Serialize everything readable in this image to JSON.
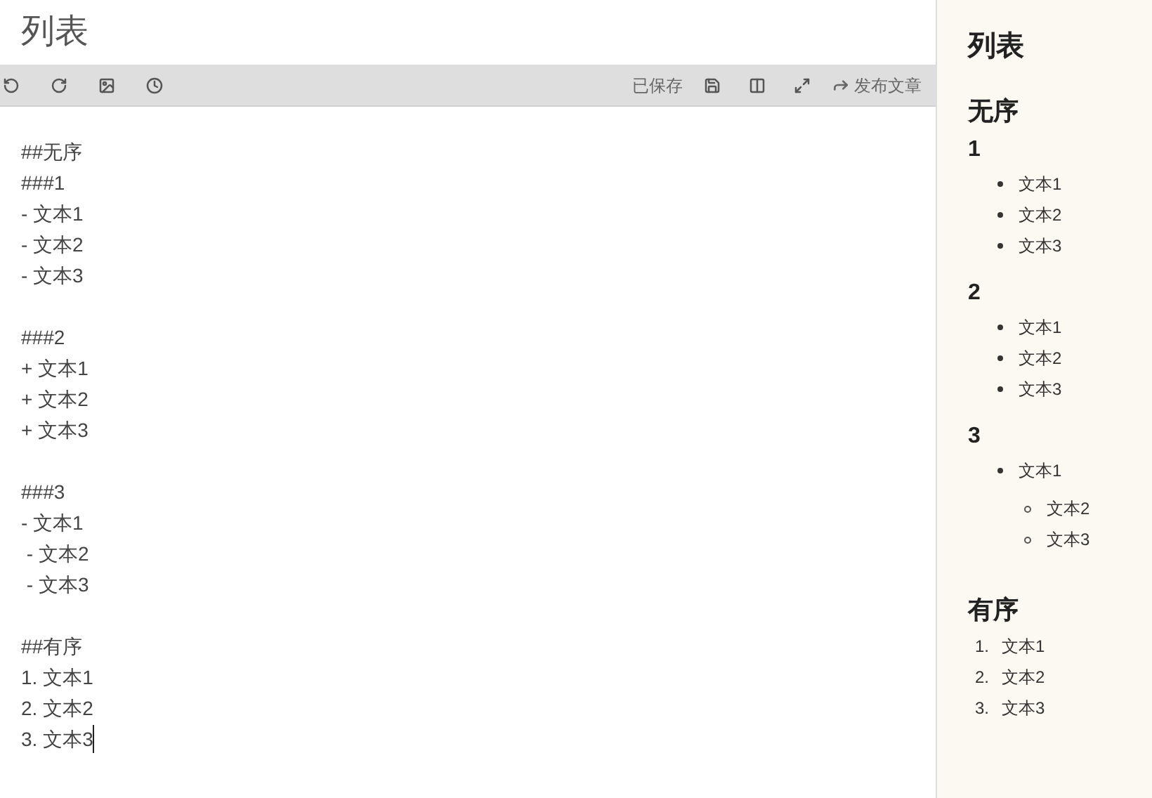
{
  "editor": {
    "title": "列表",
    "toolbar": {
      "status": "已保存",
      "publish_label": "发布文章"
    },
    "blocks": [
      [
        "##无序",
        "###1",
        "- 文本1",
        "- 文本2",
        "- 文本3"
      ],
      [
        "###2",
        "+ 文本1",
        "+ 文本2",
        "+ 文本3"
      ],
      [
        "###3",
        "- 文本1",
        " - 文本2",
        " - 文本3"
      ],
      [
        "##有序",
        "1. 文本1",
        "2. 文本2",
        "3. 文本3"
      ]
    ]
  },
  "preview": {
    "title": "列表",
    "sections": [
      {
        "heading": "无序",
        "parts": [
          {
            "heading": "1",
            "kind": "bulleted",
            "items": [
              {
                "text": "文本1"
              },
              {
                "text": "文本2"
              },
              {
                "text": "文本3"
              }
            ]
          },
          {
            "heading": "2",
            "kind": "bulleted",
            "items": [
              {
                "text": "文本1"
              },
              {
                "text": "文本2"
              },
              {
                "text": "文本3"
              }
            ]
          },
          {
            "heading": "3",
            "kind": "bulleted",
            "items": [
              {
                "text": "文本1",
                "children": [
                  {
                    "text": "文本2"
                  },
                  {
                    "text": "文本3"
                  }
                ]
              }
            ]
          }
        ]
      },
      {
        "heading": "有序",
        "parts": [
          {
            "kind": "numbered",
            "items": [
              {
                "marker": "1.",
                "text": "文本1"
              },
              {
                "marker": "2.",
                "text": "文本2"
              },
              {
                "marker": "3.",
                "text": "文本3"
              }
            ]
          }
        ]
      }
    ]
  }
}
